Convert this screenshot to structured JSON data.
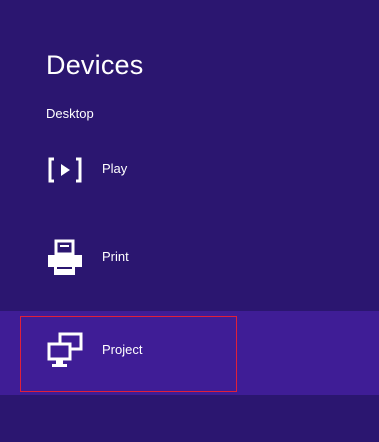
{
  "charm": {
    "title": "Devices",
    "subtitle": "Desktop",
    "items": [
      {
        "label": "Play",
        "icon": "play-to-icon"
      },
      {
        "label": "Print",
        "icon": "printer-icon"
      },
      {
        "label": "Project",
        "icon": "project-icon"
      }
    ],
    "selected_item": "Project"
  },
  "colors": {
    "background": "#2b1670",
    "selected_background": "#3f1d96",
    "focus_border": "#e0203a",
    "text": "#ffffff"
  }
}
